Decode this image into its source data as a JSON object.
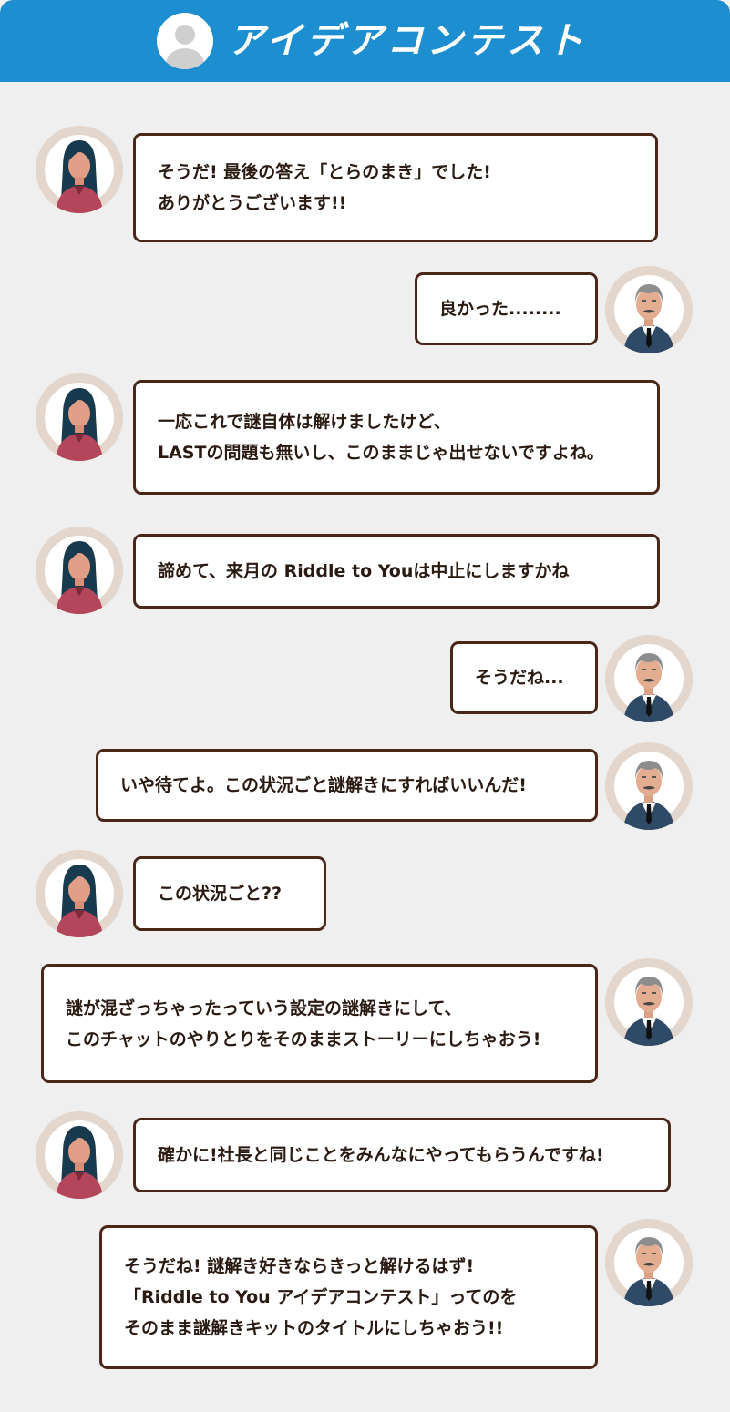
{
  "header": {
    "title": "アイデアコンテスト",
    "icon": "user-icon"
  },
  "messages": [
    {
      "speaker": "woman",
      "lines": [
        "そうだ! 最後の答え「とらのまき」でした!",
        "ありがとうございます!!"
      ]
    },
    {
      "speaker": "boss",
      "lines": [
        "良かった........"
      ]
    },
    {
      "speaker": "woman",
      "lines": [
        "一応これで謎自体は解けましたけど、",
        "LASTの問題も無いし、このままじゃ出せないですよね。"
      ]
    },
    {
      "speaker": "woman",
      "lines": [
        "諦めて、来月の Riddle to Youは中止にしますかね"
      ]
    },
    {
      "speaker": "boss",
      "lines": [
        "そうだね..."
      ]
    },
    {
      "speaker": "boss",
      "lines": [
        "いや待てよ。この状況ごと謎解きにすればいいんだ!"
      ]
    },
    {
      "speaker": "woman",
      "lines": [
        "この状況ごと??"
      ]
    },
    {
      "speaker": "boss",
      "lines": [
        "謎が混ざっちゃったっていう設定の謎解きにして、",
        "このチャットのやりとりをそのままストーリーにしちゃおう!"
      ]
    },
    {
      "speaker": "woman",
      "lines": [
        "確かに!社長と同じことをみんなにやってもらうんですね!"
      ]
    },
    {
      "speaker": "boss",
      "lines": [
        "そうだね! 謎解き好きならきっと解けるはず!",
        "「Riddle to You アイデアコンテスト」ってのを",
        "そのまま謎解きキットのタイトルにしちゃおう!!"
      ]
    }
  ],
  "colors": {
    "header_bg": "#1d8fd0",
    "page_bg": "#efefef",
    "bubble_border": "#4a2719",
    "avatar_ring": "#e3d7cd"
  },
  "avatars": {
    "woman": "woman-avatar-icon",
    "boss": "boss-avatar-icon"
  }
}
